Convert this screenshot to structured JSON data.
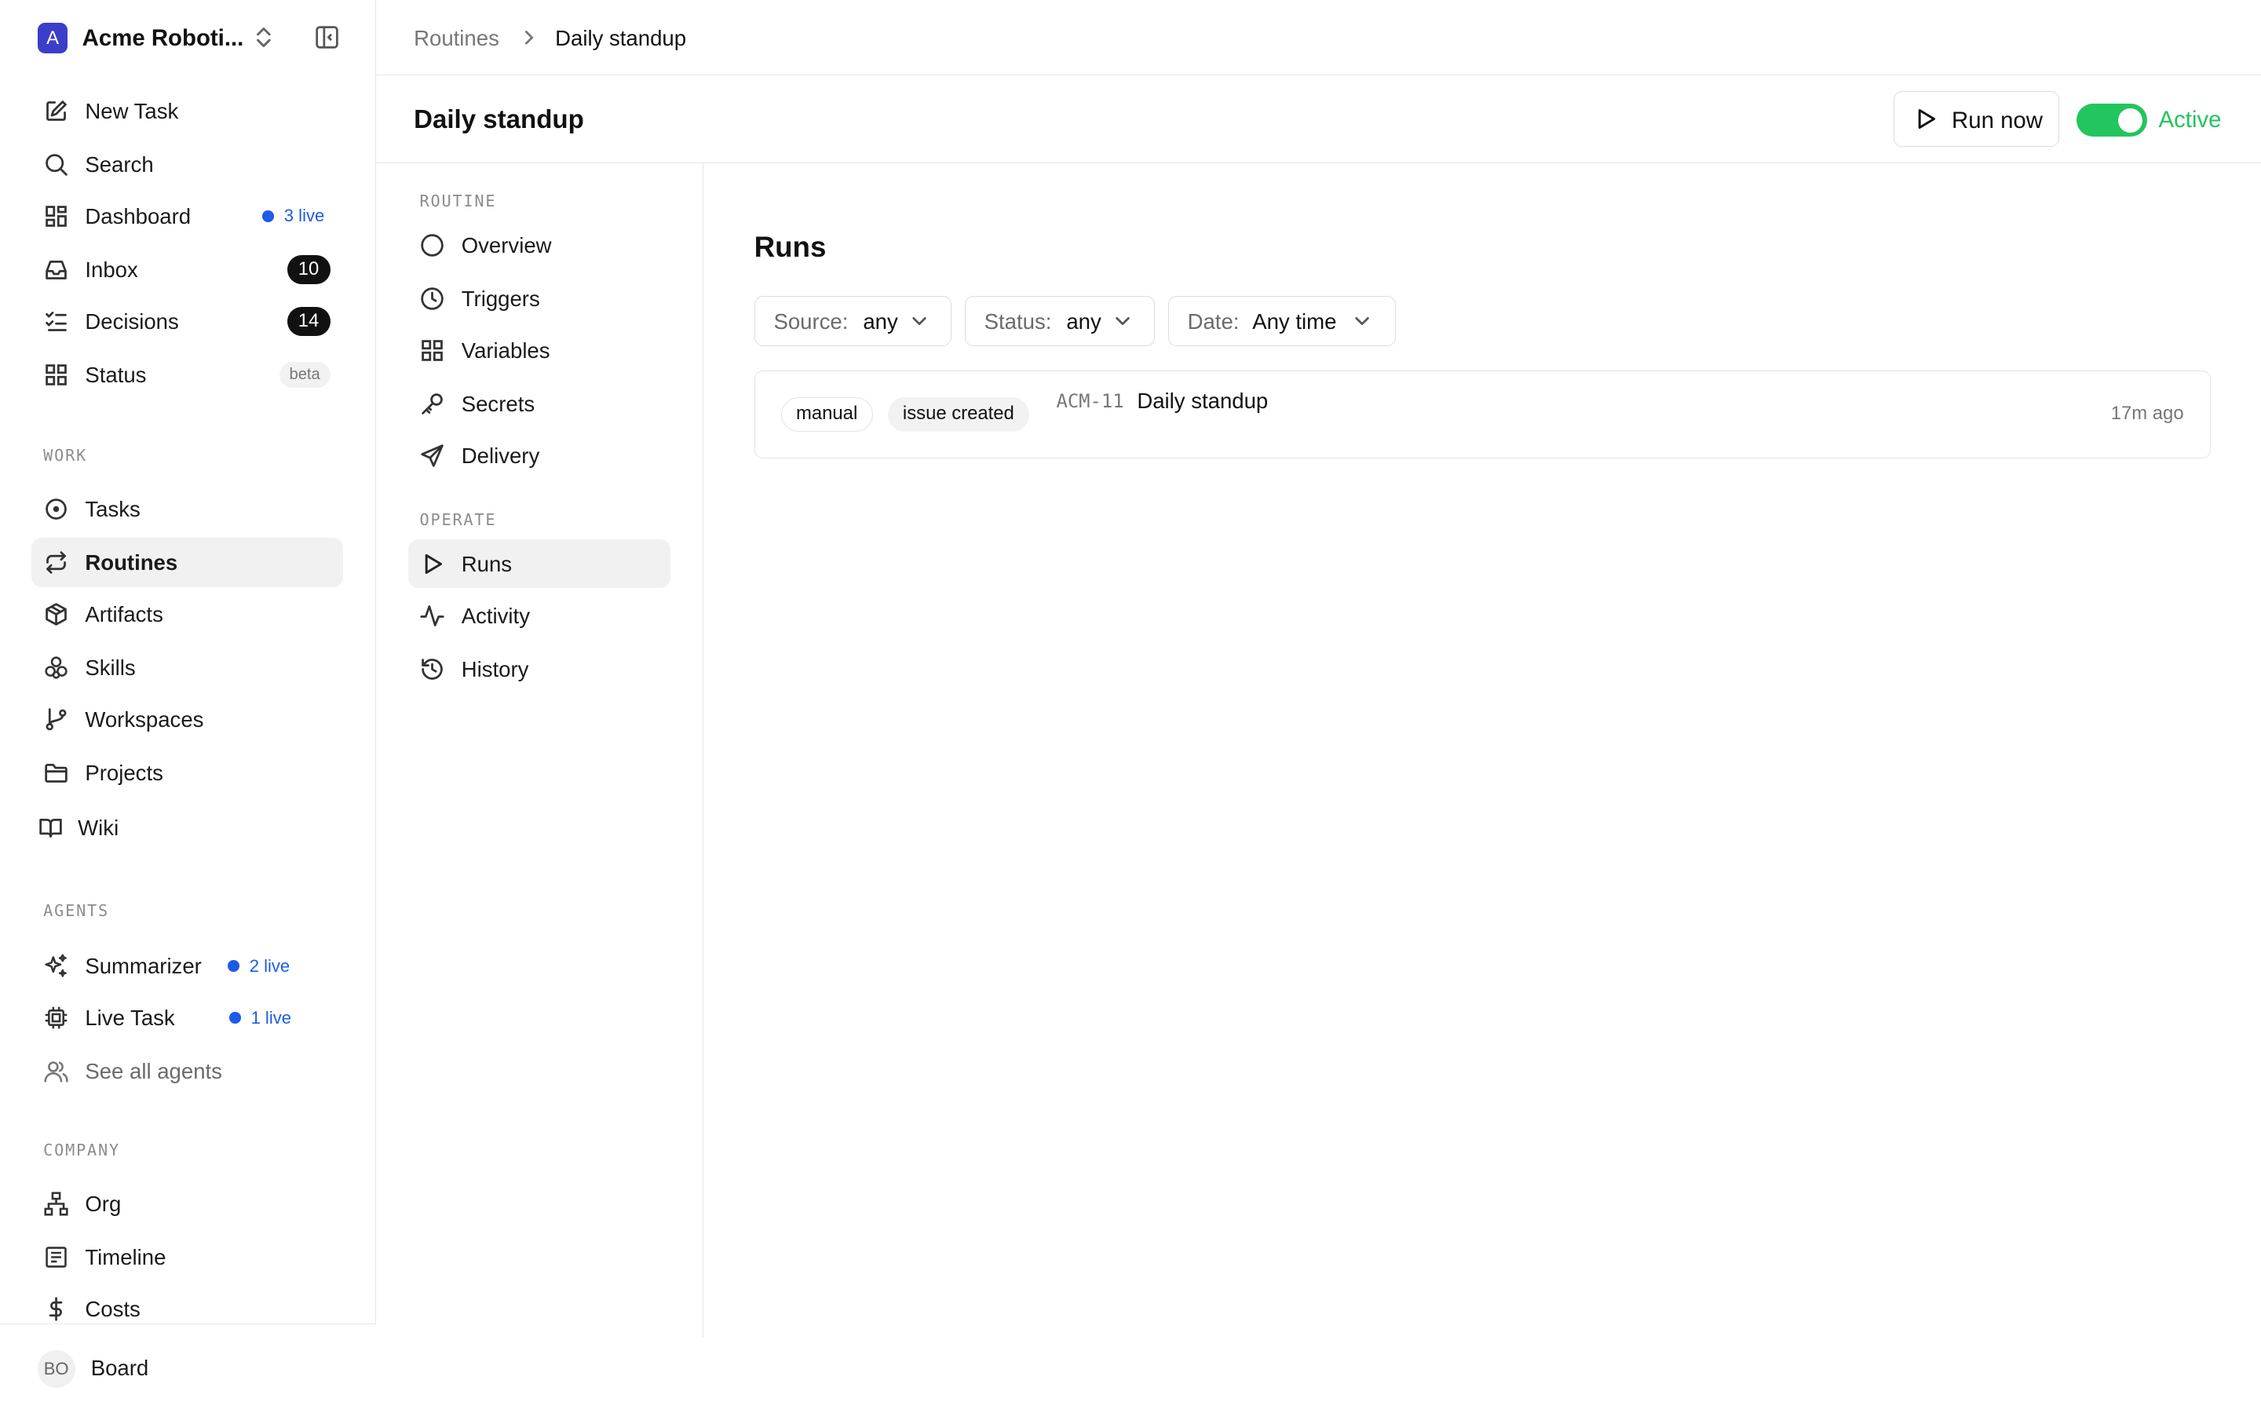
{
  "workspace": {
    "logo_letter": "A",
    "name": "Acme Roboti..."
  },
  "sidebar": {
    "primary": [
      {
        "label": "New Task",
        "icon": "edit-icon"
      },
      {
        "label": "Search",
        "icon": "search-icon"
      },
      {
        "label": "Dashboard",
        "icon": "dashboard-icon",
        "live": "3 live"
      },
      {
        "label": "Inbox",
        "icon": "inbox-icon",
        "count": "10"
      },
      {
        "label": "Decisions",
        "icon": "list-check-icon",
        "count": "14"
      },
      {
        "label": "Status",
        "icon": "grid-icon",
        "badge": "beta"
      }
    ],
    "work_label": "WORK",
    "work": [
      {
        "label": "Tasks",
        "icon": "circle-dot-icon"
      },
      {
        "label": "Routines",
        "icon": "repeat-icon",
        "active": true
      },
      {
        "label": "Artifacts",
        "icon": "box-icon"
      },
      {
        "label": "Skills",
        "icon": "skills-icon"
      },
      {
        "label": "Workspaces",
        "icon": "git-branch-icon"
      },
      {
        "label": "Projects",
        "icon": "folder-icon"
      },
      {
        "label": "Wiki",
        "icon": "book-icon"
      }
    ],
    "agents_label": "AGENTS",
    "agents": [
      {
        "label": "Summarizer",
        "icon": "sparkles-icon",
        "live": "2 live"
      },
      {
        "label": "Live Task",
        "icon": "cpu-icon",
        "live": "1 live"
      },
      {
        "label": "See all agents",
        "icon": "users-icon"
      }
    ],
    "company_label": "COMPANY",
    "company": [
      {
        "label": "Org",
        "icon": "org-icon"
      },
      {
        "label": "Timeline",
        "icon": "timeline-icon"
      },
      {
        "label": "Costs",
        "icon": "dollar-icon"
      }
    ],
    "footer": {
      "initials": "BO",
      "name": "Board"
    }
  },
  "breadcrumb": {
    "parent": "Routines",
    "current": "Daily standup"
  },
  "header": {
    "title": "Daily standup",
    "run_now": "Run now",
    "status": "Active",
    "active": true
  },
  "subnav": {
    "routine_label": "ROUTINE",
    "routine": [
      {
        "label": "Overview",
        "icon": "circle-icon"
      },
      {
        "label": "Triggers",
        "icon": "clock-icon"
      },
      {
        "label": "Variables",
        "icon": "grid-icon"
      },
      {
        "label": "Secrets",
        "icon": "key-icon"
      },
      {
        "label": "Delivery",
        "icon": "send-icon"
      }
    ],
    "operate_label": "OPERATE",
    "operate": [
      {
        "label": "Runs",
        "icon": "play-icon",
        "active": true
      },
      {
        "label": "Activity",
        "icon": "activity-icon"
      },
      {
        "label": "History",
        "icon": "history-icon"
      }
    ]
  },
  "main": {
    "title": "Runs",
    "filters": [
      {
        "key": "Source:",
        "value": "any"
      },
      {
        "key": "Status:",
        "value": "any"
      },
      {
        "key": "Date:",
        "value": "Any time"
      }
    ],
    "runs": [
      {
        "tags": [
          "manual",
          "issue created"
        ],
        "id": "ACM-11",
        "name": "Daily standup",
        "time": "17m ago"
      }
    ]
  },
  "colors": {
    "accent_blue": "#1d5be8",
    "active_green": "#22c55e",
    "logo": "#3b3ec9"
  }
}
